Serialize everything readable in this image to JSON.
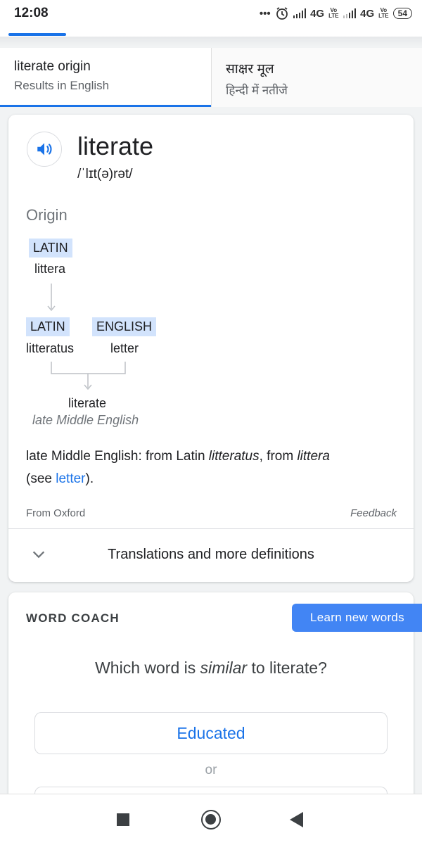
{
  "status_bar": {
    "time": "12:08",
    "dots": "•••",
    "network1": "4G",
    "network2": "4G",
    "volte1": "Vo\nLTE",
    "volte2": "Vo\nLTE",
    "battery": "54"
  },
  "tabs": [
    {
      "title": "literate origin",
      "subtitle": "Results in English"
    },
    {
      "title": "साक्षर मूल",
      "subtitle": "हिन्दी में नतीजे"
    }
  ],
  "dictionary": {
    "word": "literate",
    "phonetic": "/ˈlɪt(ə)rət/",
    "origin_label": "Origin",
    "etymology": {
      "top": {
        "lang": "LATIN",
        "word": "littera"
      },
      "left": {
        "lang": "LATIN",
        "word": "litteratus"
      },
      "right": {
        "lang": "ENGLISH",
        "word": "letter"
      },
      "result": {
        "word": "literate",
        "lang": "late Middle English"
      }
    },
    "description": {
      "part1": "late Middle English: from Latin ",
      "italic1": "litteratus",
      "part2": ", from ",
      "italic2": "littera",
      "part3": "(see ",
      "link": "letter",
      "part4": ")."
    },
    "source": "From Oxford",
    "feedback": "Feedback",
    "more": "Translations and more definitions"
  },
  "word_coach": {
    "title": "WORD COACH",
    "learn_button": "Learn new words",
    "question_pre": "Which word is ",
    "question_italic": "similar",
    "question_post": " to literate?",
    "option1": "Educated",
    "or": "or"
  },
  "colors": {
    "accent": "#1a73e8",
    "highlight": "#d2e3fc",
    "button": "#4285f4"
  }
}
